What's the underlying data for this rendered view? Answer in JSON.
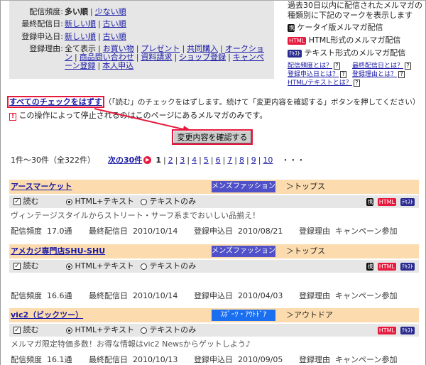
{
  "filter": {
    "freq": {
      "label": "配信頻度:",
      "current": "多い順",
      "link": "少ない順"
    },
    "last": {
      "label": "最終配信日:",
      "link1": "新しい順",
      "link2": "古い順"
    },
    "reg": {
      "label": "登録申込日:",
      "link1": "新しい順",
      "link2": "古い順"
    },
    "reason": {
      "label": "登録理由:",
      "current": "全て表示",
      "links": [
        "お買い物",
        "プレゼント",
        "共同購入",
        "オークション",
        "商品問い合わせ",
        "資料請求",
        "ショップ登録",
        "キャンペーン登録",
        "本人申込"
      ]
    }
  },
  "legend": {
    "intro": "過去30日以内に配信されたメルマガの種類別に下記のマークを表示します",
    "mobile": {
      "badge": "携",
      "label": "ケータイ版メルマガ配信"
    },
    "html": {
      "badge": "HTML",
      "label": "HTML形式のメルマガ配信"
    },
    "text": {
      "badge": "ﾃｷｽﾄ",
      "label": "テキスト形式のメルマガ配信"
    },
    "help": [
      "配信頻度とは？",
      "最終配信日とは？",
      "登録申込日とは？",
      "登録理由とは？",
      "HTML/テキストとは？"
    ],
    "q": "?"
  },
  "uncheck": {
    "link": "すべてのチェックをはずす",
    "desc": "（「読む」のチェックをはずします。続けて「変更内容を確認する」ボタンを押してください）",
    "warning_icon": "!",
    "warning": "この操作によって停止されるのはこのページにあるメルマガのみです。"
  },
  "confirm_button": "変更内容を確認する",
  "pager": {
    "range": "1件～30件（全322件）",
    "next": "次の30件",
    "current": "1",
    "pages": [
      "2",
      "3",
      "4",
      "5",
      "6",
      "7",
      "8",
      "9",
      "10"
    ],
    "more": "・・・"
  },
  "labels": {
    "read": "読む",
    "html_text": "HTML+テキスト",
    "text_only": "テキストのみ",
    "freq": "配信頻度",
    "last": "最終配信日",
    "reg": "登録申込日",
    "reason": "登録理由"
  },
  "items": [
    {
      "name": "アースマーケット",
      "category": "メンズファッション",
      "cat_color": "#5050c8",
      "sub": "＞トップス",
      "desc": "ヴィンテージスタイルからストリート・サーフ系までおいしい品揃え！",
      "freq": "17.0通",
      "last": "2010/10/14",
      "reg": "2010/08/21",
      "reason": "キャンペーン参加",
      "badges": [
        "mobile",
        "html",
        "text"
      ]
    },
    {
      "name": "アメカジ専門店SHU-SHU",
      "category": "メンズファッション",
      "cat_color": "#5050c8",
      "sub": "＞トップス",
      "desc": "",
      "freq": "16.6通",
      "last": "2010/10/14",
      "reg": "2010/04/03",
      "reason": "キャンペーン参加",
      "badges": [
        "mobile",
        "html",
        "text"
      ]
    },
    {
      "name": "vic2（ビックツー）",
      "category": "ｽﾎﾟｰﾂ・ｱｳﾄﾄﾞｱ",
      "cat_color": "#1a6ef0",
      "sub": "＞アウトドア",
      "desc": "メルマガ限定特価多数！お得な情報はvic2 Newsからゲットしよう♪",
      "freq": "16.1通",
      "last": "2010/10/13",
      "reg": "2010/09/05",
      "reason": "キャンペーン参加",
      "badges": [
        "html",
        "text"
      ]
    }
  ]
}
